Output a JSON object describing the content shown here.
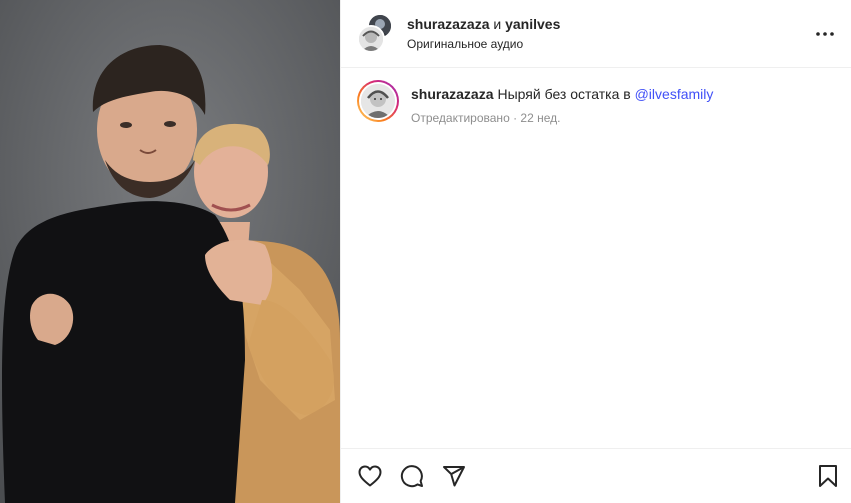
{
  "header": {
    "user1": "shurazazaza",
    "conjunction": "и",
    "user2": "yanilves",
    "audio": "Оригинальное аудио",
    "more_icon": "more-horizontal-icon"
  },
  "caption": {
    "username": "shurazazaza",
    "text": "Ныряй без остатка в",
    "mention": "@ilvesfamily",
    "meta": "Отредактировано · 22 нед."
  },
  "actions": {
    "like_icon": "heart-icon",
    "comment_icon": "comment-icon",
    "share_icon": "share-icon",
    "save_icon": "bookmark-icon"
  }
}
